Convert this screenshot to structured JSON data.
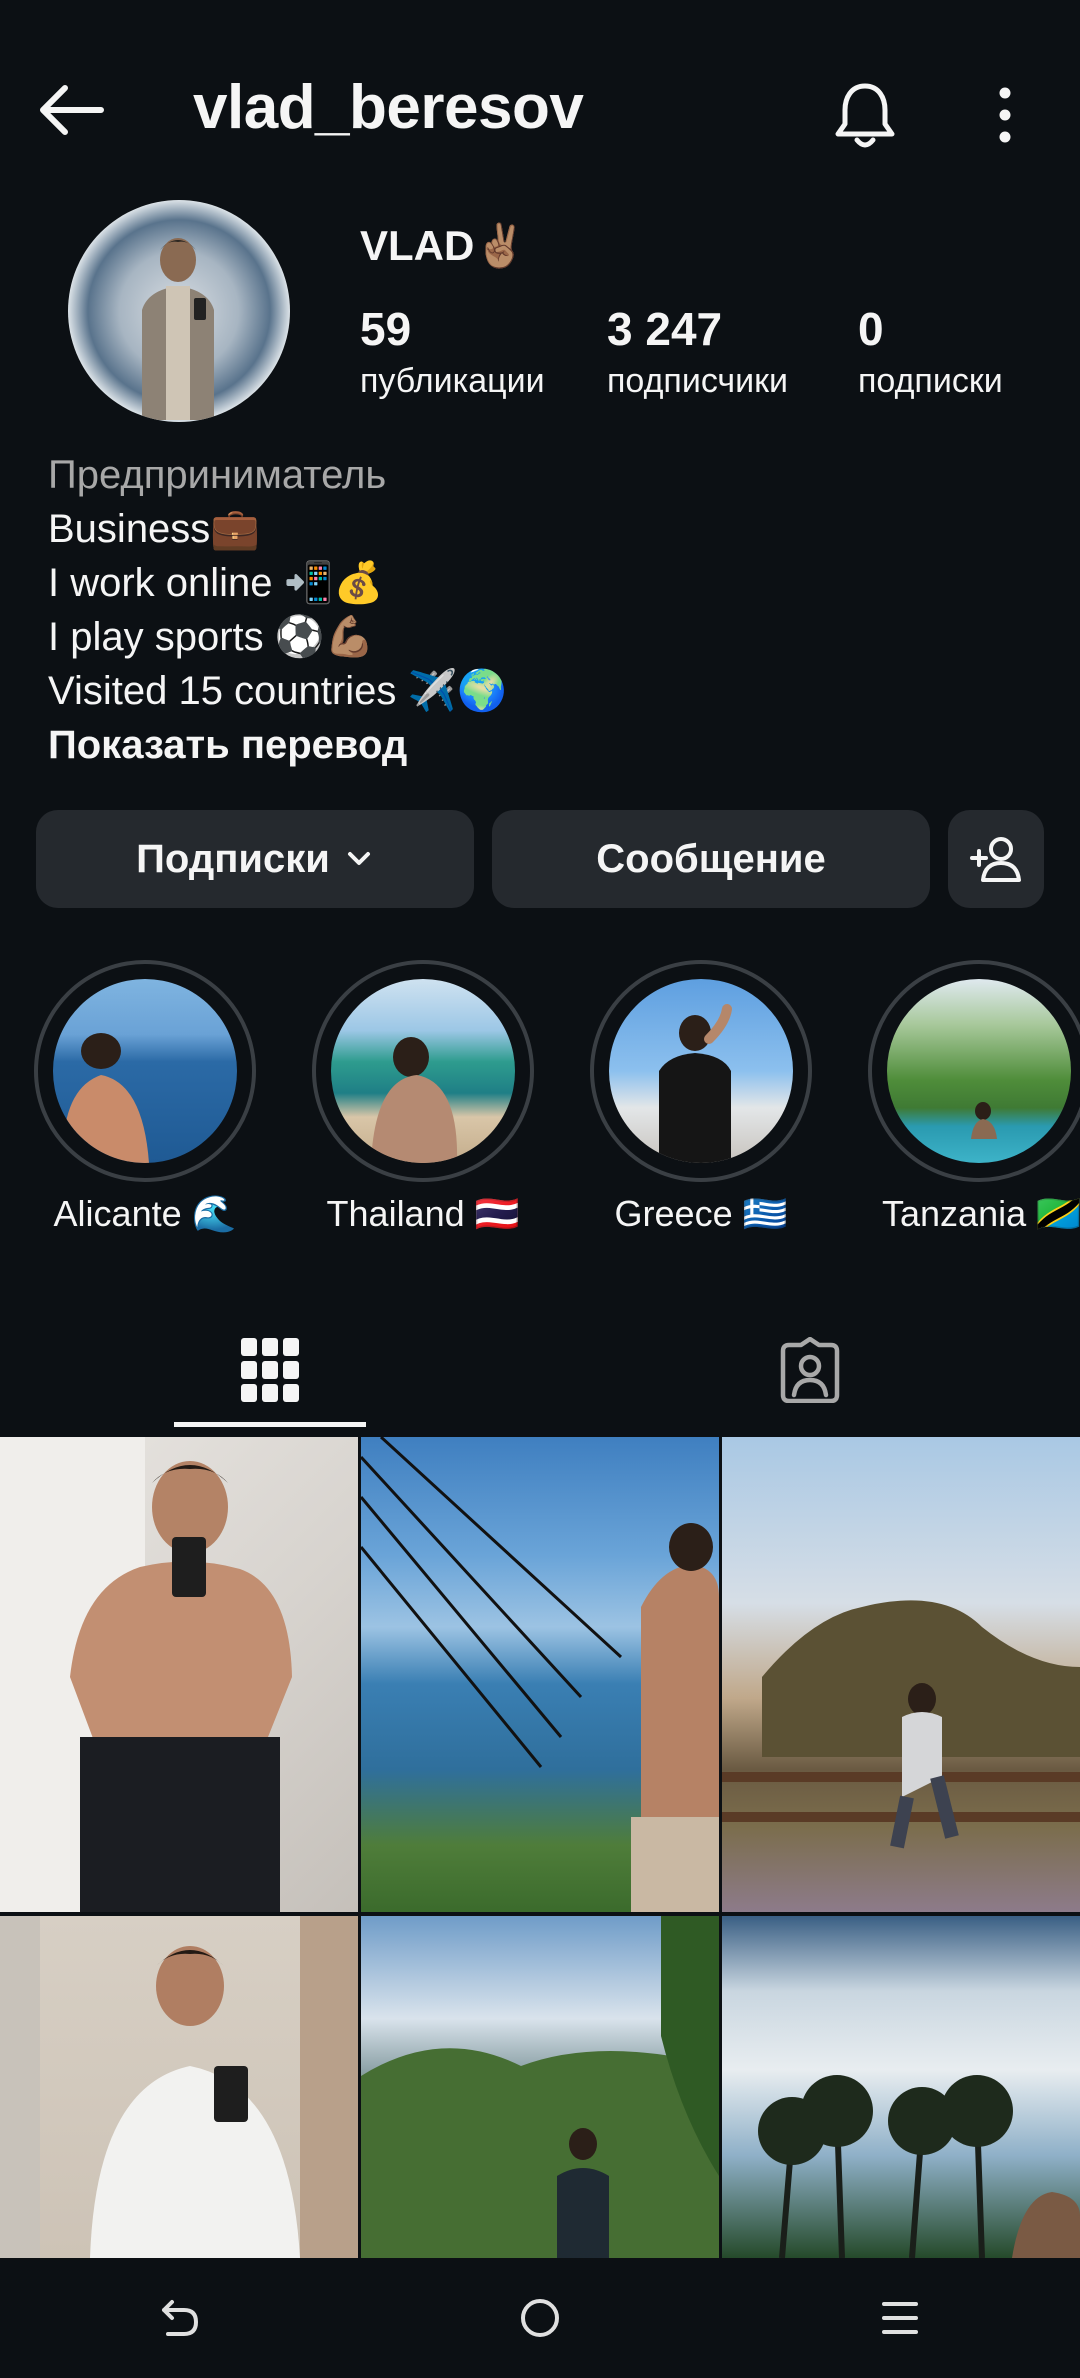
{
  "header": {
    "username": "vlad_beresov"
  },
  "profile": {
    "display_name": "VLAD✌🏽",
    "stats": [
      {
        "value": "59",
        "label": "публикации"
      },
      {
        "value": "3 247",
        "label": "подписчики"
      },
      {
        "value": "0",
        "label": "подписки"
      }
    ],
    "bio": {
      "category": "Предприниматель",
      "lines": [
        "Business💼",
        "I work online 📲💰",
        "I play sports ⚽💪🏽",
        "Visited 15 countries ✈️🌍"
      ],
      "translate_label": "Показать перевод"
    }
  },
  "actions": {
    "following_label": "Подписки",
    "message_label": "Сообщение"
  },
  "highlights": [
    {
      "label": "Alicante 🌊"
    },
    {
      "label": "Thailand 🇹🇭"
    },
    {
      "label": "Greece 🇬🇷"
    },
    {
      "label": "Tanzania 🇹🇿"
    }
  ],
  "tabs": [
    {
      "icon": "grid-icon",
      "selected": true
    },
    {
      "icon": "tagged-icon",
      "selected": false
    }
  ],
  "icons": {
    "back": "arrow-left-icon",
    "bell": "bell-icon",
    "more": "more-vertical-icon",
    "add_person": "add-person-icon",
    "nav": [
      "nav-back-icon",
      "nav-home-icon",
      "nav-recents-icon"
    ]
  },
  "colors": {
    "background": "#0c1014",
    "button": "#25292e",
    "text": "#f5f5f5",
    "muted": "#a8a8a8"
  }
}
